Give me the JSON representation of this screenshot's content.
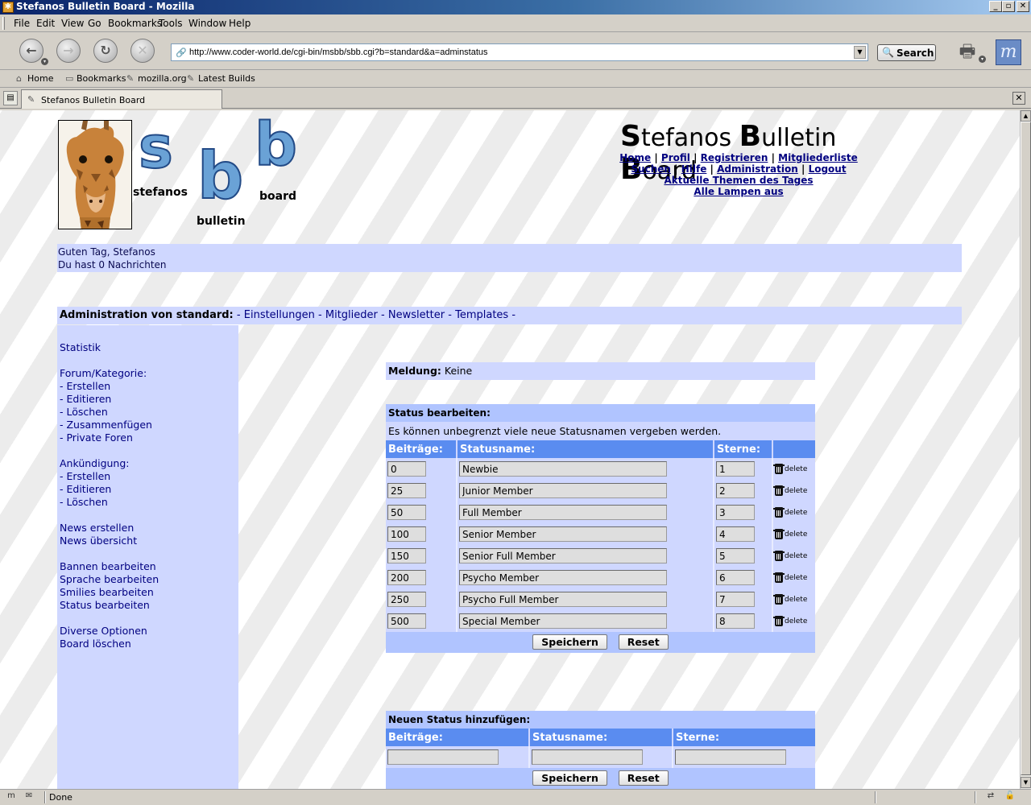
{
  "window": {
    "title": "Stefanos Bulletin Board - Mozilla",
    "app_icon": "mozilla-icon"
  },
  "menu": [
    "File",
    "Edit",
    "View",
    "Go",
    "Bookmarks",
    "Tools",
    "Window",
    "Help"
  ],
  "nav": {
    "url": "http://www.coder-world.de/cgi-bin/msbb/sbb.cgi?b=standard&a=adminstatus",
    "search_label": "Search"
  },
  "personal_toolbar": [
    "Home",
    "Bookmarks",
    "mozilla.org",
    "Latest Builds"
  ],
  "tab": {
    "title": "Stefanos Bulletin Board"
  },
  "statusbar": {
    "text": "Done"
  },
  "logo": {
    "letters": [
      "s",
      "b",
      "b"
    ],
    "words": [
      "stefanos",
      "bulletin",
      "board"
    ]
  },
  "site": {
    "title_parts": [
      {
        "cap": "S",
        "rest": "tefanos "
      },
      {
        "cap": "B",
        "rest": "ulletin "
      },
      {
        "cap": "B",
        "rest": "oard"
      }
    ],
    "nav_lines": [
      [
        "Home",
        "Profil",
        "Registrieren",
        "Mitgliederliste"
      ],
      [
        "Suchen",
        "Hilfe",
        "Administration",
        "Logout"
      ],
      [
        "Aktuelle Themen des Tages"
      ],
      [
        "Alle Lampen aus"
      ]
    ]
  },
  "greeting": {
    "line1": "Guten Tag, Stefanos",
    "line2": "Du hast 0 Nachrichten"
  },
  "admin": {
    "label": "Administration von standard:",
    "links": [
      "Einstellungen",
      "Mitglieder",
      "Newsletter",
      "Templates"
    ]
  },
  "sidebar": {
    "groups": [
      {
        "heading": "",
        "links": [
          "Statistik"
        ]
      },
      {
        "heading": "Forum/Kategorie:",
        "links": [
          "- Erstellen",
          "- Editieren",
          "- Löschen",
          "- Zusammenfügen",
          "- Private Foren"
        ]
      },
      {
        "heading": "Ankündigung:",
        "links": [
          "- Erstellen",
          "- Editieren",
          "- Löschen"
        ]
      },
      {
        "heading": "",
        "links": [
          "News erstellen",
          "News übersicht"
        ]
      },
      {
        "heading": "",
        "links": [
          "Bannen bearbeiten",
          "Sprache bearbeiten",
          "Smilies bearbeiten",
          "Status bearbeiten"
        ]
      },
      {
        "heading": "",
        "links": [
          "Diverse Optionen",
          "Board löschen"
        ]
      }
    ]
  },
  "message": {
    "label": "Meldung:",
    "value": "Keine"
  },
  "status_edit": {
    "title": "Status bearbeiten:",
    "description": "Es können unbegrenzt viele neue Statusnamen vergeben werden.",
    "columns": [
      "Beiträge:",
      "Statusname:",
      "Sterne:",
      ""
    ],
    "rows": [
      {
        "posts": "0",
        "name": "Newbie",
        "stars": "1"
      },
      {
        "posts": "25",
        "name": "Junior Member",
        "stars": "2"
      },
      {
        "posts": "50",
        "name": "Full Member",
        "stars": "3"
      },
      {
        "posts": "100",
        "name": "Senior Member",
        "stars": "4"
      },
      {
        "posts": "150",
        "name": "Senior Full Member",
        "stars": "5"
      },
      {
        "posts": "200",
        "name": "Psycho Member",
        "stars": "6"
      },
      {
        "posts": "250",
        "name": "Psycho Full Member",
        "stars": "7"
      },
      {
        "posts": "500",
        "name": "Special Member",
        "stars": "8"
      }
    ],
    "delete_label": "delete",
    "save_label": "Speichern",
    "reset_label": "Reset"
  },
  "status_new": {
    "title": "Neuen Status hinzufügen:",
    "columns": [
      "Beiträge:",
      "Statusname:",
      "Sterne:"
    ],
    "save_label": "Speichern",
    "reset_label": "Reset"
  },
  "colors": {
    "panel_light": "#cfd7ff",
    "panel_mid": "#b0c4ff",
    "header_blue": "#5a8cf0",
    "link": "#000080"
  }
}
